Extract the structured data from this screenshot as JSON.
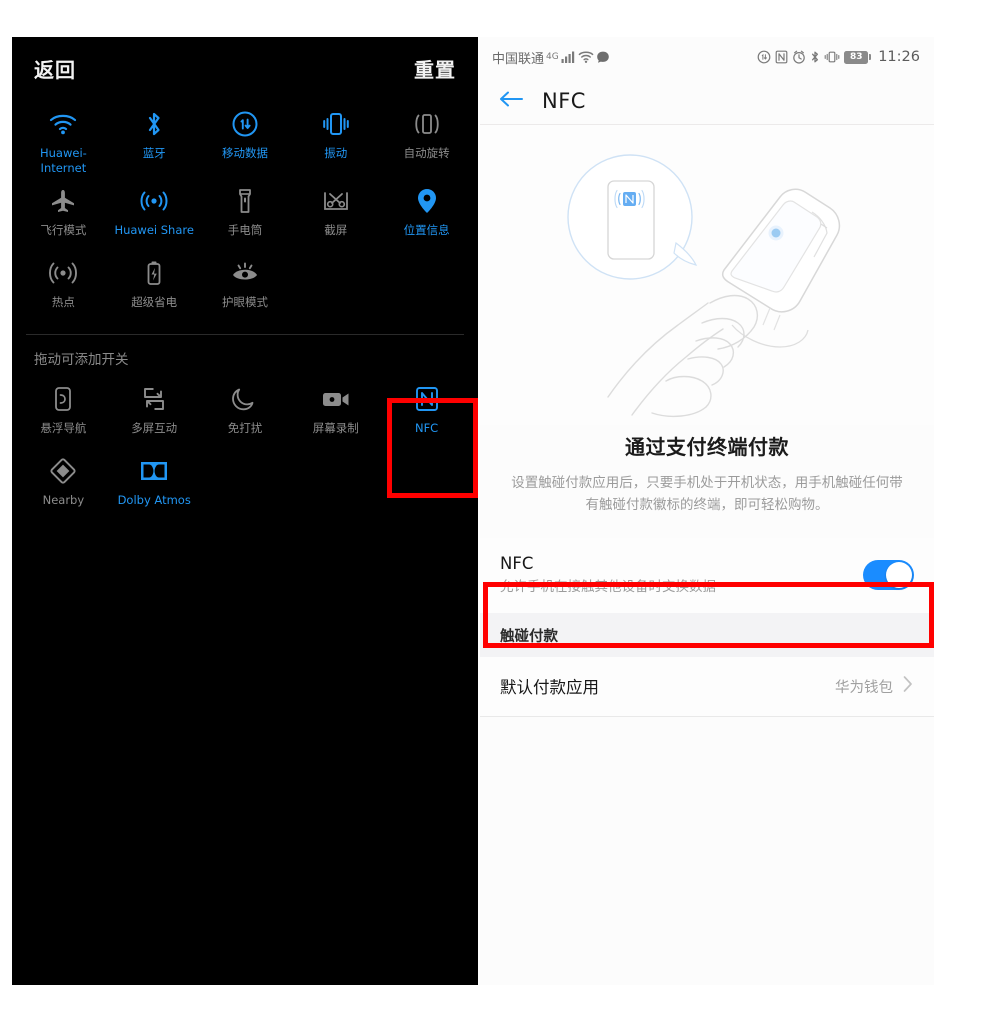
{
  "quick_settings": {
    "back_label": "返回",
    "reset_label": "重置",
    "section_title": "拖动可添加开关",
    "active_color": "#2196f3",
    "inactive_color": "#8c8c8c",
    "tiles": [
      {
        "icon": "wifi-icon",
        "label": "Huawei-Internet",
        "state": "on"
      },
      {
        "icon": "bluetooth-icon",
        "label": "蓝牙",
        "state": "on"
      },
      {
        "icon": "mobile-data-icon",
        "label": "移动数据",
        "state": "on"
      },
      {
        "icon": "vibrate-icon",
        "label": "振动",
        "state": "on"
      },
      {
        "icon": "auto-rotate-icon",
        "label": "自动旋转",
        "state": "off"
      },
      {
        "icon": "airplane-mode-icon",
        "label": "飞行模式",
        "state": "off"
      },
      {
        "icon": "huawei-share-icon",
        "label": "Huawei Share",
        "state": "on"
      },
      {
        "icon": "flashlight-icon",
        "label": "手电筒",
        "state": "off"
      },
      {
        "icon": "screenshot-icon",
        "label": "截屏",
        "state": "off"
      },
      {
        "icon": "location-icon",
        "label": "位置信息",
        "state": "on"
      },
      {
        "icon": "hotspot-icon",
        "label": "热点",
        "state": "off"
      },
      {
        "icon": "ultra-power-saving-icon",
        "label": "超级省电",
        "state": "off"
      },
      {
        "icon": "eye-comfort-icon",
        "label": "护眼模式",
        "state": "off"
      }
    ],
    "drawer_tiles": [
      {
        "icon": "floating-nav-icon",
        "label": "悬浮导航",
        "state": "off"
      },
      {
        "icon": "multi-screen-icon",
        "label": "多屏互动",
        "state": "off"
      },
      {
        "icon": "do-not-disturb-icon",
        "label": "免打扰",
        "state": "off"
      },
      {
        "icon": "screen-recorder-icon",
        "label": "屏幕录制",
        "state": "off"
      },
      {
        "icon": "nfc-icon",
        "label": "NFC",
        "state": "on"
      },
      {
        "icon": "nearby-icon",
        "label": "Nearby",
        "state": "off"
      },
      {
        "icon": "dolby-atmos-icon",
        "label": "Dolby Atmos",
        "state": "on"
      }
    ]
  },
  "nfc_screen": {
    "status_bar": {
      "carrier": "中国联通",
      "network_type": "4G",
      "icons": [
        "signal-bars-icon",
        "wifi-icon",
        "message-dot-icon",
        "data-saver-icon",
        "nfc-icon",
        "alarm-icon",
        "bluetooth-icon",
        "vibrate-icon"
      ],
      "battery_percent": "83",
      "time": "11:26"
    },
    "app_bar": {
      "back_icon": "back-arrow-icon",
      "title": "NFC"
    },
    "illustration": {
      "name": "nfc-pay-terminal-illustration",
      "badge": "nfc-n-logo"
    },
    "hero_title": "通过支付终端付款",
    "hero_desc": "设置触碰付款应用后，只要手机处于开机状态，用手机触碰任何带有触碰付款徽标的终端，即可轻松购物。",
    "nfc_toggle": {
      "title": "NFC",
      "subtitle": "允许手机在接触其他设备时交换数据",
      "value": "on",
      "accent": "#1a8cff"
    },
    "group_header": "触碰付款",
    "default_payment_row": {
      "label": "默认付款应用",
      "value": "华为钱包",
      "chevron": "chevron-right-icon"
    }
  },
  "annotations": {
    "highlight_color": "#ff0000",
    "boxes": [
      "nfc-tile-highlight",
      "nfc-toggle-row-highlight"
    ]
  }
}
